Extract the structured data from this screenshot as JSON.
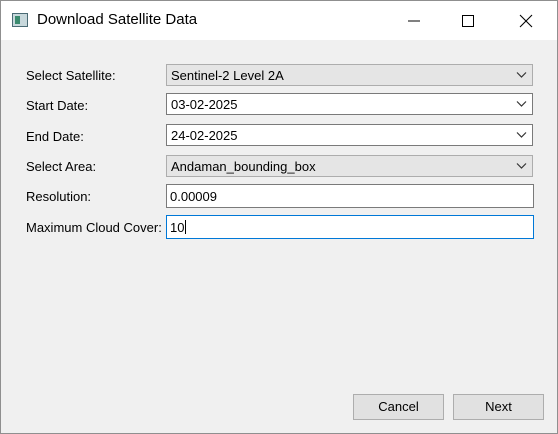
{
  "window": {
    "title": "Download Satellite Data"
  },
  "form": {
    "satellite": {
      "label": "Select Satellite:",
      "value": "Sentinel-2 Level 2A"
    },
    "start_date": {
      "label": "Start Date:",
      "value": "03-02-2025"
    },
    "end_date": {
      "label": "End Date:",
      "value": "24-02-2025"
    },
    "area": {
      "label": "Select Area:",
      "value": "Andaman_bounding_box"
    },
    "resolution": {
      "label": "Resolution:",
      "value": "0.00009"
    },
    "cloud_cover": {
      "label": "Maximum Cloud Cover:",
      "value": "10"
    }
  },
  "buttons": {
    "cancel": "Cancel",
    "next": "Next"
  },
  "icons": {
    "app": "satellite-app-icon",
    "minimize": "minimize-icon",
    "maximize": "maximize-icon",
    "close": "close-icon",
    "dropdown": "chevron-down-icon"
  },
  "colors": {
    "focus_border": "#0078d7",
    "dialog_background": "#f0f0f0"
  }
}
